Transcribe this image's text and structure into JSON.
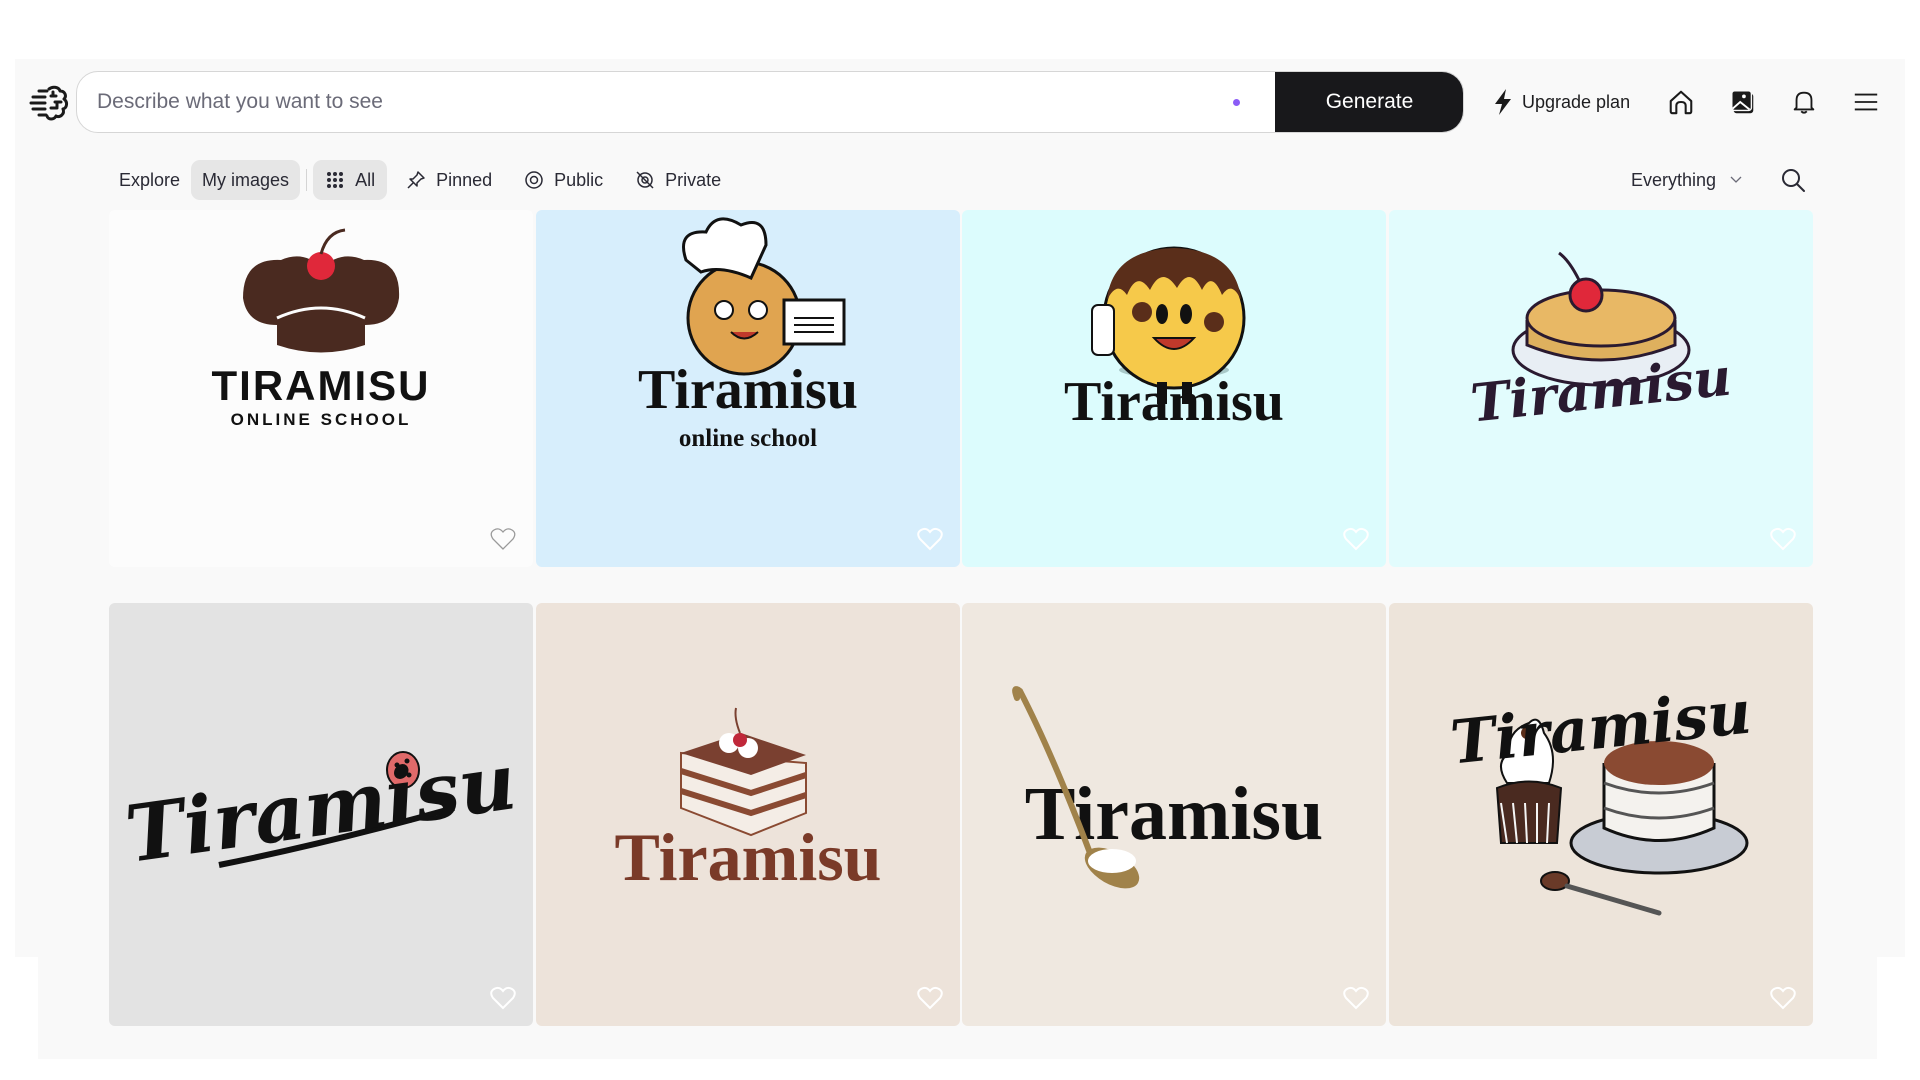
{
  "header": {
    "search_placeholder": "Describe what you want to see",
    "search_value": "",
    "generate_label": "Generate",
    "upgrade_label": "Upgrade plan",
    "accent_dot_color": "#8b5cf6"
  },
  "nav_icons": [
    "home-icon",
    "my-images-icon",
    "bell-icon",
    "menu-icon"
  ],
  "filters": {
    "explore": "Explore",
    "my_images": "My images",
    "all": "All",
    "pinned": "Pinned",
    "public": "Public",
    "private": "Private",
    "visibility_select": "Everything"
  },
  "gallery": [
    {
      "title": "TIRAMISU",
      "subtitle": "ONLINE SCHOOL",
      "background": "#fcfcfc",
      "subject": "chocolate chef hat with cherry",
      "pinned": false
    },
    {
      "title": "Tiramisu",
      "subtitle": "online school",
      "background": "#d7eefc",
      "subject": "cookie chef mascot holding certificate",
      "pinned": false
    },
    {
      "title": "Tiramisu",
      "subtitle": "",
      "background": "#dcfcfd",
      "subject": "chocolate-dipped cookie mascot with diploma",
      "pinned": false
    },
    {
      "title": "Tiramisu",
      "subtitle": "",
      "background": "#e2fcfd",
      "subject": "layered cake on plate with cherry",
      "pinned": false
    },
    {
      "title": "Tiramisu",
      "subtitle": "",
      "background": "#e3e3e3",
      "subject": "script lettering with ladybug",
      "pinned": false
    },
    {
      "title": "Tiramisu",
      "subtitle": "",
      "background": "#ede3da",
      "subject": "tiramisu slice with cream and cherry",
      "pinned": false
    },
    {
      "title": "Tiramisu",
      "subtitle": "",
      "background": "#efe8e0",
      "subject": "gold spoon with cream",
      "pinned": false
    },
    {
      "title": "Tiramisu",
      "subtitle": "",
      "background": "#ede4da",
      "subject": "cupcake, tiramisu cake and spoon",
      "pinned": false
    }
  ]
}
